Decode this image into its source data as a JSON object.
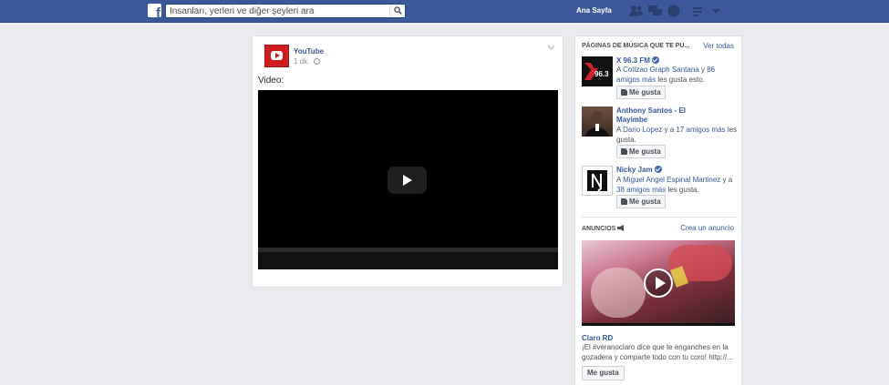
{
  "header": {
    "search_placeholder": "İnsanları, yerleri ve diğer şeyleri ara",
    "home_label": "Ana Sayfa"
  },
  "post": {
    "author": "YouTube",
    "time": "1 dk.",
    "text": "Video:"
  },
  "music_pages": {
    "title": "PÁGINAS DE MÚSICA QUE TE PU...",
    "see_all": "Ver todas",
    "items": [
      {
        "name": "X 96.3 FM",
        "verified": true,
        "friend": "Cotizao Graph Santana",
        "sep": " y ",
        "others": "86 amigos más",
        "suffix": " les gusta esto.",
        "like_label": "Me gusta"
      },
      {
        "name": "Anthony Santos - El Mayimbe",
        "verified": false,
        "friend": "Dario Lopez",
        "sep": " y a ",
        "others": "17 amigos más",
        "suffix": " les gusta.",
        "like_label": "Me gusta"
      },
      {
        "name": "Nicky Jam",
        "verified": true,
        "friend": "Miguel Angel Espinal Martinez",
        "sep": " y a ",
        "others": "38 amigos más",
        "suffix": " les gusta.",
        "like_label": "Me gusta"
      }
    ]
  },
  "ads": {
    "title": "ANUNCIOS",
    "create": "Crea un anuncio",
    "advertiser": "Claro RD",
    "description": "¡El #veranoclaro dice que te enganches en la gozadera y comparte todo con tu coro! http://...",
    "like_label": "Me gusta"
  },
  "colors": {
    "topbar": "#3b5998",
    "link": "#365899",
    "background": "#e9ebee"
  }
}
